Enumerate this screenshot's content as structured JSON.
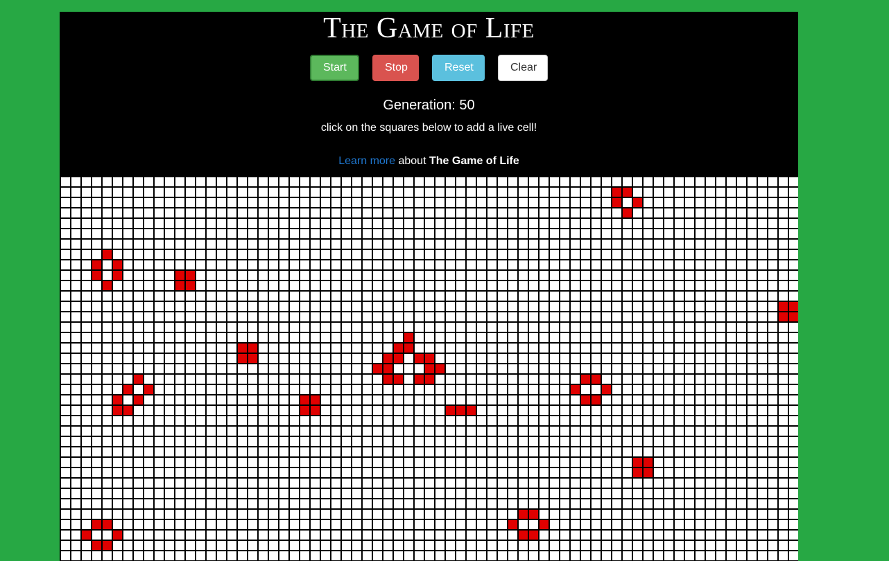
{
  "app": {
    "title": "The Game of Life"
  },
  "controls": {
    "start_label": "Start",
    "stop_label": "Stop",
    "reset_label": "Reset",
    "clear_label": "Clear"
  },
  "status": {
    "generation_text": "Generation: 50",
    "instructions": "click on the squares below to add a live cell!"
  },
  "learn_more": {
    "link_text": "Learn more",
    "middle_text": "about",
    "bold_text": "The Game of Life"
  },
  "colors": {
    "page_background": "#27a844",
    "header_background": "#000000",
    "live_cell": "#e00000",
    "dead_cell": "#ffffff",
    "grid_line": "#000000",
    "link": "#1f78d1"
  },
  "grid": {
    "columns": 71,
    "rows": 37,
    "live_cells": [
      [
        1,
        53
      ],
      [
        1,
        54
      ],
      [
        2,
        53
      ],
      [
        2,
        55
      ],
      [
        3,
        54
      ],
      [
        7,
        4
      ],
      [
        8,
        3
      ],
      [
        8,
        5
      ],
      [
        9,
        3
      ],
      [
        9,
        5
      ],
      [
        10,
        4
      ],
      [
        9,
        11
      ],
      [
        9,
        12
      ],
      [
        10,
        11
      ],
      [
        10,
        12
      ],
      [
        12,
        69
      ],
      [
        12,
        70
      ],
      [
        13,
        69
      ],
      [
        13,
        70
      ],
      [
        15,
        33
      ],
      [
        16,
        17
      ],
      [
        16,
        18
      ],
      [
        16,
        32
      ],
      [
        16,
        33
      ],
      [
        17,
        17
      ],
      [
        17,
        18
      ],
      [
        17,
        31
      ],
      [
        17,
        32
      ],
      [
        17,
        34
      ],
      [
        17,
        35
      ],
      [
        18,
        30
      ],
      [
        18,
        31
      ],
      [
        18,
        35
      ],
      [
        18,
        36
      ],
      [
        19,
        7
      ],
      [
        19,
        31
      ],
      [
        19,
        32
      ],
      [
        19,
        34
      ],
      [
        19,
        35
      ],
      [
        19,
        50
      ],
      [
        19,
        51
      ],
      [
        20,
        6
      ],
      [
        20,
        8
      ],
      [
        20,
        49
      ],
      [
        20,
        52
      ],
      [
        21,
        5
      ],
      [
        21,
        7
      ],
      [
        21,
        23
      ],
      [
        21,
        24
      ],
      [
        21,
        50
      ],
      [
        21,
        51
      ],
      [
        22,
        5
      ],
      [
        22,
        6
      ],
      [
        22,
        23
      ],
      [
        22,
        24
      ],
      [
        22,
        37
      ],
      [
        22,
        38
      ],
      [
        22,
        39
      ],
      [
        27,
        55
      ],
      [
        27,
        56
      ],
      [
        28,
        55
      ],
      [
        28,
        56
      ],
      [
        32,
        44
      ],
      [
        32,
        45
      ],
      [
        33,
        3
      ],
      [
        33,
        4
      ],
      [
        33,
        43
      ],
      [
        33,
        46
      ],
      [
        34,
        2
      ],
      [
        34,
        5
      ],
      [
        34,
        44
      ],
      [
        34,
        45
      ],
      [
        35,
        3
      ],
      [
        35,
        4
      ]
    ]
  }
}
